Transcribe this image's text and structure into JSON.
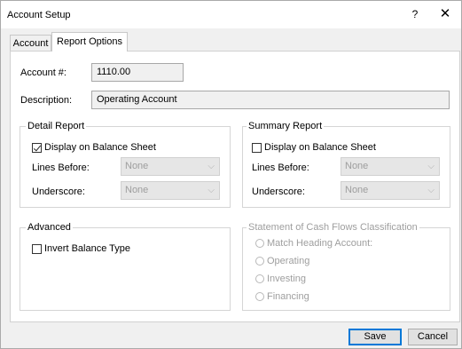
{
  "window": {
    "title": "Account Setup",
    "help_label": "?",
    "close_label": "✕"
  },
  "tabs": [
    {
      "label": "Account"
    },
    {
      "label": "Report Options"
    }
  ],
  "account": {
    "number_label": "Account #:",
    "number_value": "1110.00",
    "description_label": "Description:",
    "description_value": "Operating Account"
  },
  "detail_report": {
    "title": "Detail Report",
    "display_label": "Display on Balance Sheet",
    "display_checked": true,
    "lines_before_label": "Lines Before:",
    "lines_before_value": "None",
    "underscore_label": "Underscore:",
    "underscore_value": "None"
  },
  "summary_report": {
    "title": "Summary Report",
    "display_label": "Display on Balance Sheet",
    "display_checked": false,
    "lines_before_label": "Lines Before:",
    "lines_before_value": "None",
    "underscore_label": "Underscore:",
    "underscore_value": "None"
  },
  "advanced": {
    "title": "Advanced",
    "invert_label": "Invert Balance Type",
    "invert_checked": false
  },
  "cash_flows": {
    "title": "Statement of Cash Flows Classification",
    "options": [
      {
        "label": "Match Heading Account:"
      },
      {
        "label": "Operating"
      },
      {
        "label": "Investing"
      },
      {
        "label": "Financing"
      }
    ]
  },
  "buttons": {
    "save": "Save",
    "cancel": "Cancel"
  }
}
